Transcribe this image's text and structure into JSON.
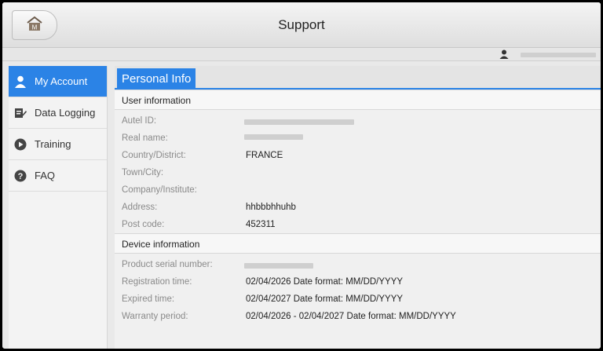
{
  "header": {
    "title": "Support",
    "home_icon": "home-m-icon"
  },
  "userbar": {
    "user_icon": "person-icon"
  },
  "sidebar": {
    "items": [
      {
        "label": "My Account",
        "icon": "person-icon",
        "active": true
      },
      {
        "label": "Data Logging",
        "icon": "edit-note-icon"
      },
      {
        "label": "Training",
        "icon": "play-circle-icon"
      },
      {
        "label": "FAQ",
        "icon": "help-circle-icon"
      }
    ]
  },
  "content": {
    "tab": "Personal Info",
    "user_section": {
      "title": "User information",
      "rows": [
        {
          "label": "Autel ID:",
          "value": ""
        },
        {
          "label": "Real name:",
          "value": ""
        },
        {
          "label": "Country/District:",
          "value": "FRANCE"
        },
        {
          "label": "Town/City:",
          "value": ""
        },
        {
          "label": "Company/Institute:",
          "value": ""
        },
        {
          "label": "Address:",
          "value": "hhbbbhhuhb"
        },
        {
          "label": "Post code:",
          "value": "452311"
        }
      ]
    },
    "device_section": {
      "title": "Device information",
      "rows": [
        {
          "label": "Product serial number:",
          "value": ""
        },
        {
          "label": "Registration time:",
          "value": "02/04/2026 Date format: MM/DD/YYYY"
        },
        {
          "label": "Expired time:",
          "value": "02/04/2027 Date format: MM/DD/YYYY"
        },
        {
          "label": "Warranty period:",
          "value": "02/04/2026 - 02/04/2027 Date format: MM/DD/YYYY"
        }
      ]
    }
  },
  "colors": {
    "accent": "#2b83e6",
    "background": "#f0f0f0"
  }
}
